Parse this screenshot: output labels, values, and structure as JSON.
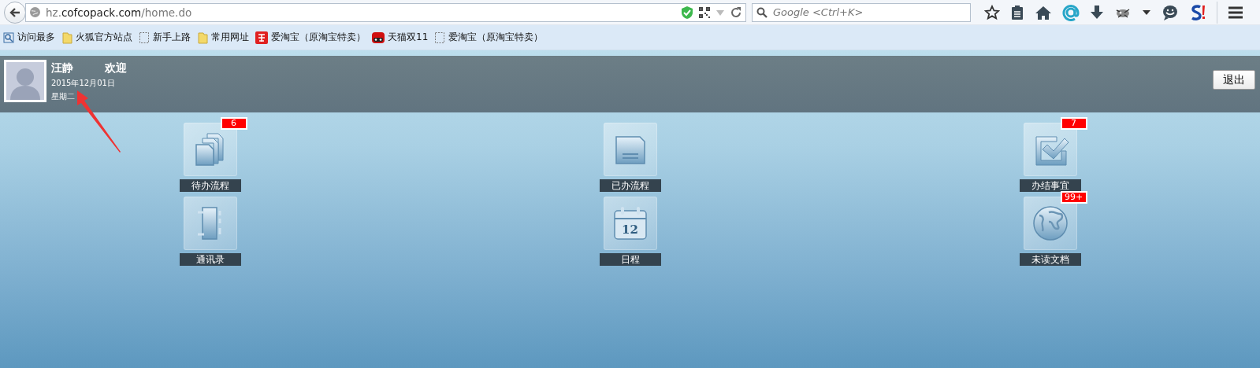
{
  "browser": {
    "url": "hz.**cofcopack.com**/home.do",
    "search_placeholder": "Google <Ctrl+K>",
    "bookmarks": [
      {
        "label": "访问最多",
        "kind": "query"
      },
      {
        "label": "火狐官方站点",
        "kind": "folder"
      },
      {
        "label": "新手上路",
        "kind": "page"
      },
      {
        "label": "常用网址",
        "kind": "folder"
      },
      {
        "label": "爱淘宝（原淘宝特卖）",
        "kind": "taobao"
      },
      {
        "label": "天猫双11",
        "kind": "tmall"
      },
      {
        "label": "爱淘宝（原淘宝特卖）",
        "kind": "page"
      }
    ]
  },
  "header": {
    "user_name": "汪静",
    "greeting": "欢迎",
    "date": "2015年12月01日",
    "weekday": "星期二",
    "logout": "退出"
  },
  "tiles": [
    {
      "label": "待办流程",
      "kind": "documents",
      "badge": "6"
    },
    {
      "label": "已办流程",
      "kind": "tray"
    },
    {
      "label": "办结事宜",
      "kind": "check",
      "badge": "7"
    },
    {
      "label": "通讯录",
      "kind": "notebook"
    },
    {
      "label": "日程",
      "kind": "calendar",
      "icon_text": "12"
    },
    {
      "label": "未读文档",
      "kind": "globe",
      "badge": "99+"
    }
  ]
}
